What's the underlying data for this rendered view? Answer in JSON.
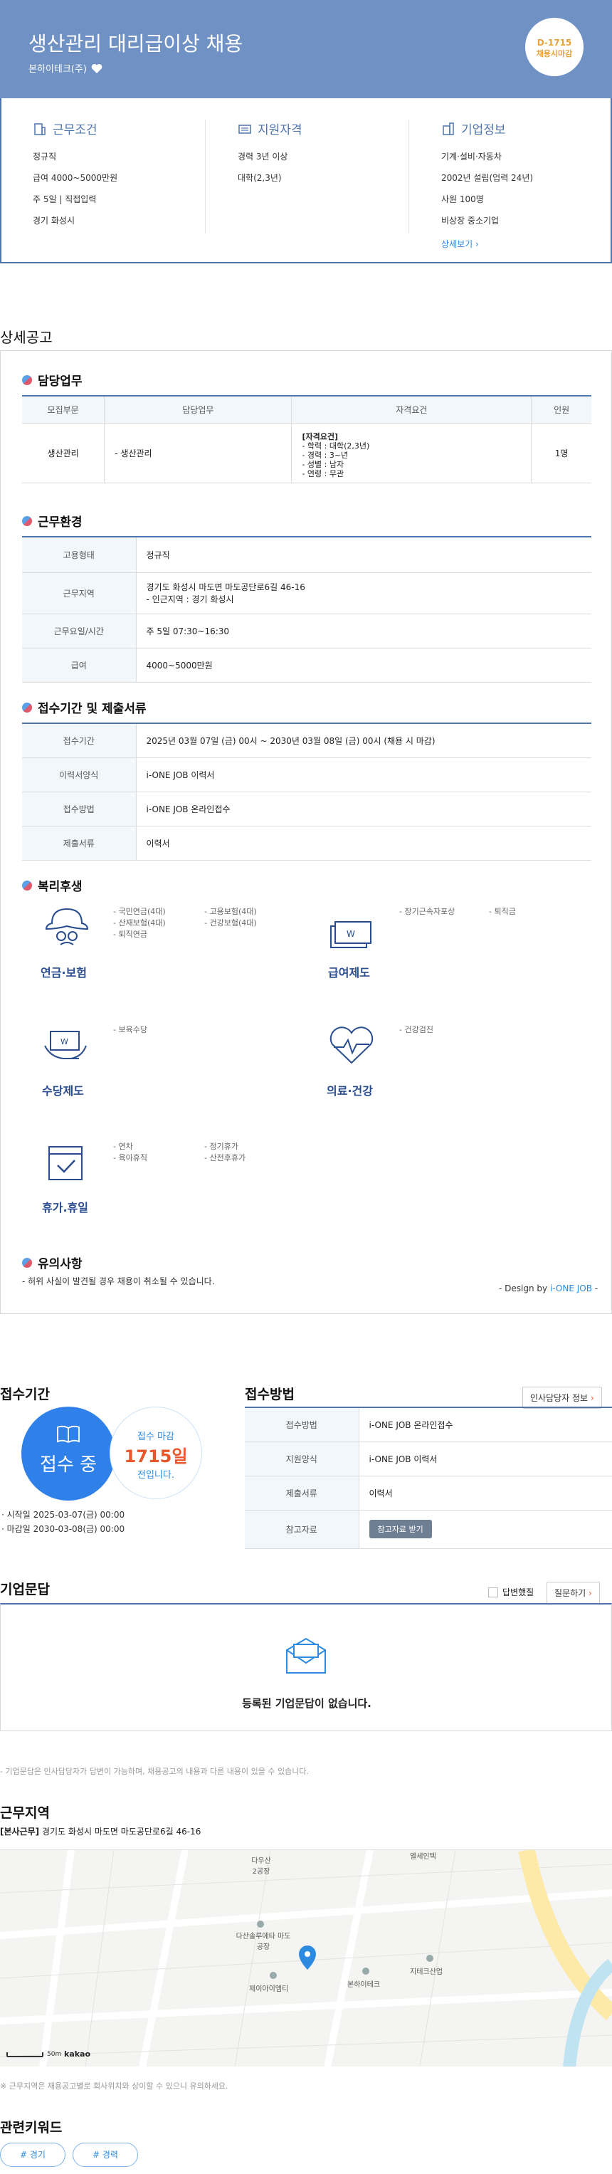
{
  "header": {
    "title": "생산관리 대리급이상 채용",
    "company": "본하이테크(주)",
    "dday": "D-1715",
    "dday_sub": "채용시마감"
  },
  "summary": {
    "conditions": {
      "title": "근무조건",
      "lines": [
        "정규직",
        "급여 4000~5000만원",
        "주 5일 | 직접입력",
        "경기 화성시"
      ]
    },
    "qualifications": {
      "title": "지원자격",
      "lines": [
        "경력 3년 이상",
        "대학(2,3년)"
      ]
    },
    "company": {
      "title": "기업정보",
      "lines": [
        "기계·설비·자동차",
        "2002년 설립(업력 24년)",
        "사원 100명",
        "비상장 중소기업"
      ],
      "more": "상세보기"
    }
  },
  "detail": {
    "section_title": "상세공고",
    "duties": {
      "title": "담당업무",
      "headers": [
        "모집부문",
        "담당업무",
        "자격요건",
        "인원"
      ],
      "row": {
        "dept": "생산관리",
        "task": "- 생산관리",
        "req_title": "[자격요건]",
        "req_lines": [
          "- 학력 : 대학(2,3년)",
          "- 경력 : 3~년",
          "- 성별 : 남자",
          "- 연령 : 무관"
        ],
        "count": "1명"
      }
    },
    "environment": {
      "title": "근무환경",
      "rows": [
        {
          "k": "고용형태",
          "v": "정규직"
        },
        {
          "k": "근무지역",
          "v": "경기도 화성시 마도면 마도공단로6길 46-16",
          "v2": "- 인근지역 : 경기 화성시"
        },
        {
          "k": "근무요일/시간",
          "v": "주 5일 07:30~16:30"
        },
        {
          "k": "급여",
          "v": "4000~5000만원"
        }
      ]
    },
    "application": {
      "title": "접수기간 및 제출서류",
      "rows": [
        {
          "k": "접수기간",
          "v": "2025년 03월 07일 (금) 00시 ~ 2030년 03월 08일 (금) 00시 (채용 시 마감)"
        },
        {
          "k": "이력서양식",
          "v": "i-ONE JOB 이력서"
        },
        {
          "k": "접수방법",
          "v": "i-ONE JOB 온라인접수"
        },
        {
          "k": "제출서류",
          "v": "이력서"
        }
      ]
    },
    "welfare": {
      "title": "복리후생",
      "items": [
        {
          "label": "연금·보험",
          "icon": "insurance-icon",
          "left": [
            "- 국민연금(4대)",
            "- 산재보험(4대)",
            "- 퇴직연금"
          ],
          "right": [
            "- 고용보험(4대)",
            "- 건강보험(4대)"
          ]
        },
        {
          "label": "급여제도",
          "icon": "salary-icon",
          "left": [
            "- 장기근속자포상"
          ],
          "right": [
            "- 퇴직금"
          ]
        },
        {
          "label": "수당제도",
          "icon": "allowance-icon",
          "left": [
            "- 보육수당"
          ],
          "right": []
        },
        {
          "label": "의료·건강",
          "icon": "health-icon",
          "left": [
            "- 건강검진"
          ],
          "right": []
        },
        {
          "label": "휴가.휴일",
          "icon": "vacation-icon",
          "left": [
            "- 연차",
            "- 육아휴직"
          ],
          "right": [
            "- 정기휴가",
            "- 산전후휴가"
          ]
        }
      ]
    },
    "caution": {
      "title": "유의사항",
      "text": "- 허위 사실이 발견될 경우 채용이 취소될 수 있습니다."
    },
    "design": {
      "prefix": "- Design by ",
      "brand": "i-ONE JOB",
      "suffix": " -"
    }
  },
  "period": {
    "title": "접수기간",
    "status": "접수 중",
    "deadline_label": "접수 마감",
    "deadline_days": "1715일",
    "deadline_suffix": "전입니다.",
    "start": "시작일 2025-03-07(금) 00:00",
    "end": "마감일 2030-03-08(금) 00:00"
  },
  "method": {
    "title": "접수방법",
    "hr_button": "인사담당자 정보",
    "rows": [
      {
        "k": "접수방법",
        "v": "i-ONE JOB 온라인접수"
      },
      {
        "k": "지원양식",
        "v": "i-ONE JOB 이력서"
      },
      {
        "k": "제출서류",
        "v": "이력서"
      },
      {
        "k": "참고자료",
        "v": "참고자료 받기"
      }
    ]
  },
  "qna": {
    "title": "기업문답",
    "answered_label": "답변했질",
    "ask_button": "질문하기",
    "empty": "등록된 기업문답이 없습니다.",
    "note": "- 기업문답은 인사담당자가 답변이 가능하며, 채용공고의 내용과 다른 내용이 있을 수 있습니다."
  },
  "location": {
    "title": "근무지역",
    "tag": "[본사근무]",
    "address": "경기도 화성시 마도면 마도공단로6길 46-16",
    "map_labels": [
      "다우산 2공장",
      "다산솔루에타 마도공장",
      "제이아이엠티",
      "본하이테크",
      "지테크산업",
      "엘세인텍"
    ],
    "scale": "50m",
    "brand": "kakao",
    "note": "※ 근무지역은 채용공고별로 회사위치와 상이할 수 있으니 유의하세요."
  },
  "keywords": {
    "title": "관련키워드",
    "items": [
      "# 경기",
      "# 경력"
    ]
  }
}
